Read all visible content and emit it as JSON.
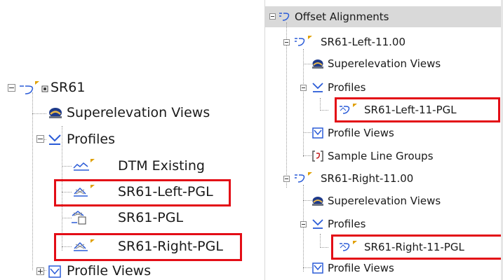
{
  "left_tree": {
    "root_label": "SR61",
    "items": [
      {
        "label": "Superelevation Views",
        "icon": "superelevation-view-icon"
      },
      {
        "label": "Profiles",
        "icon": "profiles-icon"
      },
      {
        "label": "DTM Existing",
        "icon": "surface-profile-icon"
      },
      {
        "label": "SR61-Left-PGL",
        "icon": "layout-profile-icon",
        "highlighted": true
      },
      {
        "label": "SR61-PGL",
        "icon": "profile-icon"
      },
      {
        "label": "SR61-Right-PGL",
        "icon": "layout-profile-icon",
        "highlighted": true
      },
      {
        "label": "Profile Views",
        "icon": "profile-views-icon"
      }
    ]
  },
  "right_tree": {
    "header_label": "Offset Alignments",
    "items": [
      {
        "label": "SR61-Left-11.00",
        "icon": "offset-alignment-icon"
      },
      {
        "label": "Superelevation Views",
        "icon": "superelevation-view-icon"
      },
      {
        "label": "Profiles",
        "icon": "profiles-icon"
      },
      {
        "label": "SR61-Left-11-PGL",
        "icon": "offset-profile-icon",
        "highlighted": true
      },
      {
        "label": "Profile Views",
        "icon": "profile-views-icon"
      },
      {
        "label": "Sample Line Groups",
        "icon": "sample-line-groups-icon"
      },
      {
        "label": "SR61-Right-11.00",
        "icon": "offset-alignment-icon"
      },
      {
        "label": "Superelevation Views",
        "icon": "superelevation-view-icon"
      },
      {
        "label": "Profiles",
        "icon": "profiles-icon"
      },
      {
        "label": "SR61-Right-11-PGL",
        "icon": "offset-profile-icon",
        "highlighted": true
      },
      {
        "label": "Profile Views",
        "icon": "profile-views-icon"
      }
    ]
  },
  "colors": {
    "highlight_border": "#e30d16",
    "header_background": "#d9d9d9",
    "flag": "#e0a000",
    "icon_blue": "#2a5bd7"
  }
}
